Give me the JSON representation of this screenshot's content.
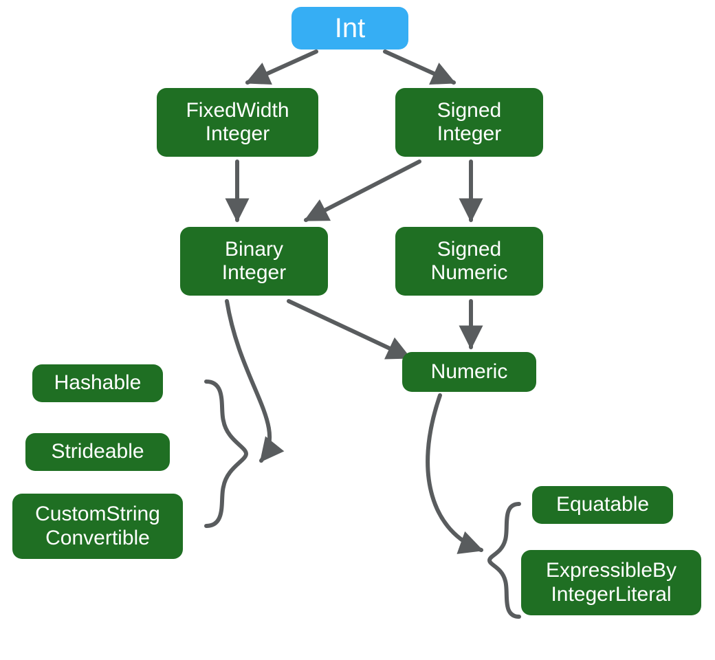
{
  "colors": {
    "green": "#1f6f23",
    "blue": "#36aef4",
    "arrow": "#595c5e"
  },
  "nodes": {
    "int": {
      "line1": "Int"
    },
    "fixedwidth_integer": {
      "line1": "FixedWidth",
      "line2": "Integer"
    },
    "signed_integer": {
      "line1": "Signed",
      "line2": "Integer"
    },
    "binary_integer": {
      "line1": "Binary",
      "line2": "Integer"
    },
    "signed_numeric": {
      "line1": "Signed",
      "line2": "Numeric"
    },
    "numeric": {
      "line1": "Numeric"
    },
    "hashable": {
      "line1": "Hashable"
    },
    "strideable": {
      "line1": "Strideable"
    },
    "customstring_conv": {
      "line1": "CustomString",
      "line2": "Convertible"
    },
    "equatable": {
      "line1": "Equatable"
    },
    "expr_int_literal": {
      "line1": "ExpressibleBy",
      "line2": "IntegerLiteral"
    }
  },
  "edges": [
    {
      "from": "int",
      "to": "fixedwidth_integer"
    },
    {
      "from": "int",
      "to": "signed_integer"
    },
    {
      "from": "fixedwidth_integer",
      "to": "binary_integer"
    },
    {
      "from": "signed_integer",
      "to": "binary_integer"
    },
    {
      "from": "signed_integer",
      "to": "signed_numeric"
    },
    {
      "from": "signed_numeric",
      "to": "numeric"
    },
    {
      "from": "binary_integer",
      "to": "numeric"
    },
    {
      "from": "binary_integer",
      "to": [
        "hashable",
        "strideable",
        "customstring_conv"
      ],
      "group": true
    },
    {
      "from": "numeric",
      "to": [
        "equatable",
        "expr_int_literal"
      ],
      "group": true
    }
  ]
}
